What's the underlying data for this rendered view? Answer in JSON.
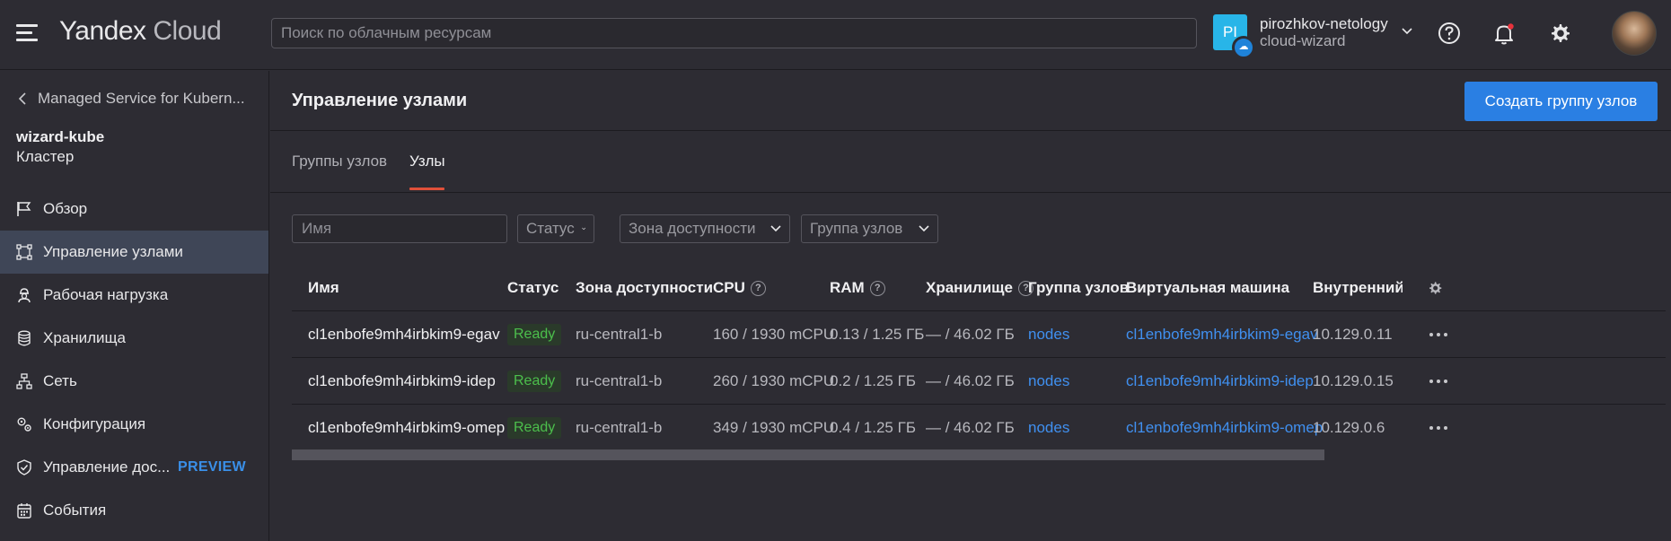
{
  "header": {
    "logo_main": "Yandex",
    "logo_sub": "Cloud",
    "search_placeholder": "Поиск по облачным ресурсам",
    "account_badge": "PI",
    "account_name": "pirozhkov-netology",
    "account_sub": "cloud-wizard"
  },
  "sidebar": {
    "back_label": "Managed Service for Kubern...",
    "cluster_name": "wizard-kube",
    "cluster_type": "Кластер",
    "items": [
      {
        "label": "Обзор",
        "icon": "flag-icon"
      },
      {
        "label": "Управление узлами",
        "icon": "nodes-icon"
      },
      {
        "label": "Рабочая нагрузка",
        "icon": "worker-icon"
      },
      {
        "label": "Хранилища",
        "icon": "database-icon"
      },
      {
        "label": "Сеть",
        "icon": "network-icon"
      },
      {
        "label": "Конфигурация",
        "icon": "config-icon"
      },
      {
        "label": "Управление дос...",
        "icon": "shield-icon",
        "tag": "PREVIEW"
      },
      {
        "label": "События",
        "icon": "calendar-icon"
      }
    ],
    "active_index": 1
  },
  "main": {
    "title": "Управление узлами",
    "create_button": "Создать группу узлов",
    "tabs": [
      {
        "label": "Группы узлов"
      },
      {
        "label": "Узлы"
      }
    ],
    "active_tab": 1,
    "filters": {
      "name_placeholder": "Имя",
      "status": "Статус",
      "zone": "Зона доступности",
      "group": "Группа узлов"
    }
  },
  "table": {
    "columns": [
      "Имя",
      "Статус",
      "Зона доступности",
      "CPU",
      "RAM",
      "Хранилище",
      "Группа узлов",
      "Виртуальная машина",
      "Внутренний I"
    ],
    "rows": [
      {
        "name": "cl1enbofe9mh4irbkim9-egav",
        "status": "Ready",
        "zone": "ru-central1-b",
        "cpu": "160 / 1930 mCPU",
        "ram": "0.13 / 1.25 ГБ",
        "storage": "— / 46.02 ГБ",
        "group": "nodes",
        "vm": "cl1enbofe9mh4irbkim9-egav",
        "ip": "10.129.0.11"
      },
      {
        "name": "cl1enbofe9mh4irbkim9-idep",
        "status": "Ready",
        "zone": "ru-central1-b",
        "cpu": "260 / 1930 mCPU",
        "ram": "0.2 / 1.25 ГБ",
        "storage": "— / 46.02 ГБ",
        "group": "nodes",
        "vm": "cl1enbofe9mh4irbkim9-idep",
        "ip": "10.129.0.15"
      },
      {
        "name": "cl1enbofe9mh4irbkim9-omep",
        "status": "Ready",
        "zone": "ru-central1-b",
        "cpu": "349 / 1930 mCPU",
        "ram": "0.4 / 1.25 ГБ",
        "storage": "— / 46.02 ГБ",
        "group": "nodes",
        "vm": "cl1enbofe9mh4irbkim9-omep",
        "ip": "10.129.0.6"
      }
    ]
  },
  "colors": {
    "accent": "#2a7fe3",
    "link": "#4090f0",
    "status_ready": "#4cbf4c",
    "active_tab_underline": "#e0503a",
    "notification_dot": "#e8323c"
  }
}
